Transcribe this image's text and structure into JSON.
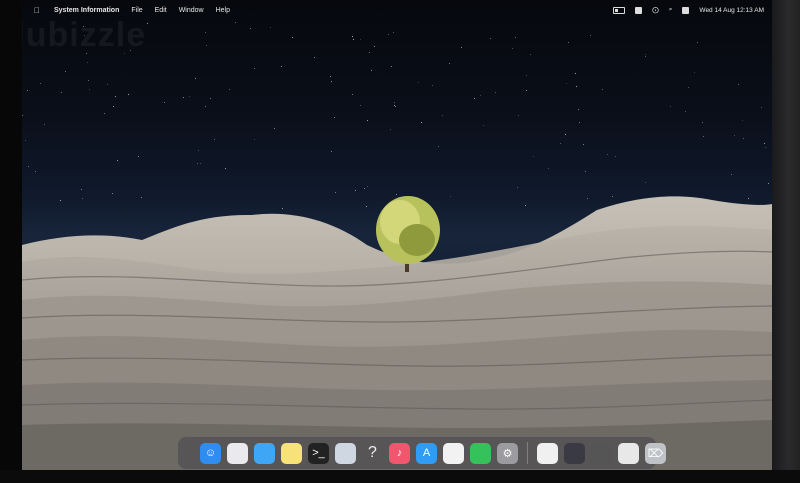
{
  "menubar": {
    "apple_icon": "apple-icon",
    "app_name": "System Information",
    "menus": [
      "File",
      "Edit",
      "Window",
      "Help"
    ]
  },
  "status": {
    "icons": [
      "battery-icon",
      "text-input-icon",
      "wifi-icon",
      "search-icon",
      "control-center-icon"
    ],
    "datetime": "Wed 14 Aug  12:13 AM"
  },
  "watermark": "dubizzle",
  "dock": {
    "apps": [
      {
        "name": "finder-icon",
        "color": "#2f8cf0"
      },
      {
        "name": "launchpad-icon",
        "color": "#e9e9ee"
      },
      {
        "name": "safari-icon",
        "color": "#3ea6f5"
      },
      {
        "name": "notes-icon",
        "color": "#f7e27a"
      },
      {
        "name": "terminal-icon",
        "color": "#222"
      },
      {
        "name": "quicktime-icon",
        "color": "#cfd8e2"
      },
      {
        "name": "help-icon",
        "color": "transparent"
      },
      {
        "name": "music-icon",
        "color": "#f2566e"
      },
      {
        "name": "app-store-icon",
        "color": "#2f9df5"
      },
      {
        "name": "chrome-icon",
        "color": "#f2f2f2"
      },
      {
        "name": "whatsapp-icon",
        "color": "#35c25a"
      },
      {
        "name": "settings-icon",
        "color": "#9b9ba0"
      }
    ],
    "recent": [
      {
        "name": "document-icon",
        "color": "#f0f0f0"
      },
      {
        "name": "window-thumbnail-1",
        "color": "#3a3a44"
      },
      {
        "name": "window-thumbnail-2",
        "color": "#555"
      },
      {
        "name": "window-thumbnail-3",
        "color": "#e8e8e8"
      },
      {
        "name": "trash-icon",
        "color": "#bfc3c8"
      }
    ]
  }
}
